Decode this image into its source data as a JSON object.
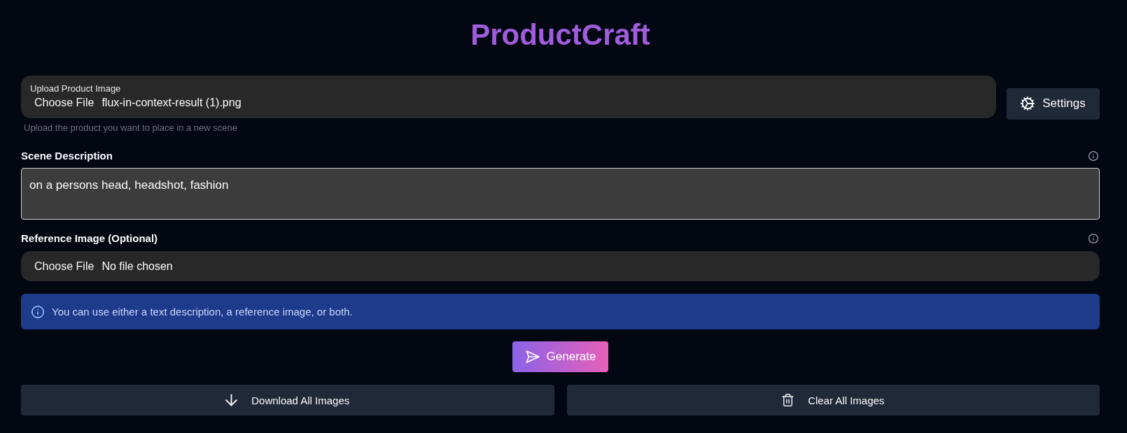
{
  "header": {
    "title": "ProductCraft"
  },
  "product_upload": {
    "label": "Upload Product Image",
    "button": "Choose File",
    "file_name": "flux-in-context-result (1).png",
    "hint": "Upload the product you want to place in a new scene"
  },
  "settings_button": {
    "label": "Settings"
  },
  "scene_description": {
    "label": "Scene Description",
    "value": "on a persons head, headshot, fashion"
  },
  "reference_image": {
    "label": "Reference Image (Optional)",
    "button": "Choose File",
    "file_name": "No file chosen"
  },
  "info_banner": {
    "text": "You can use either a text description, a reference image, or both."
  },
  "generate_button": {
    "label": "Generate"
  },
  "actions": [
    {
      "kind": "download",
      "label": "Download All Images"
    },
    {
      "kind": "clear",
      "label": "Clear All Images"
    }
  ]
}
